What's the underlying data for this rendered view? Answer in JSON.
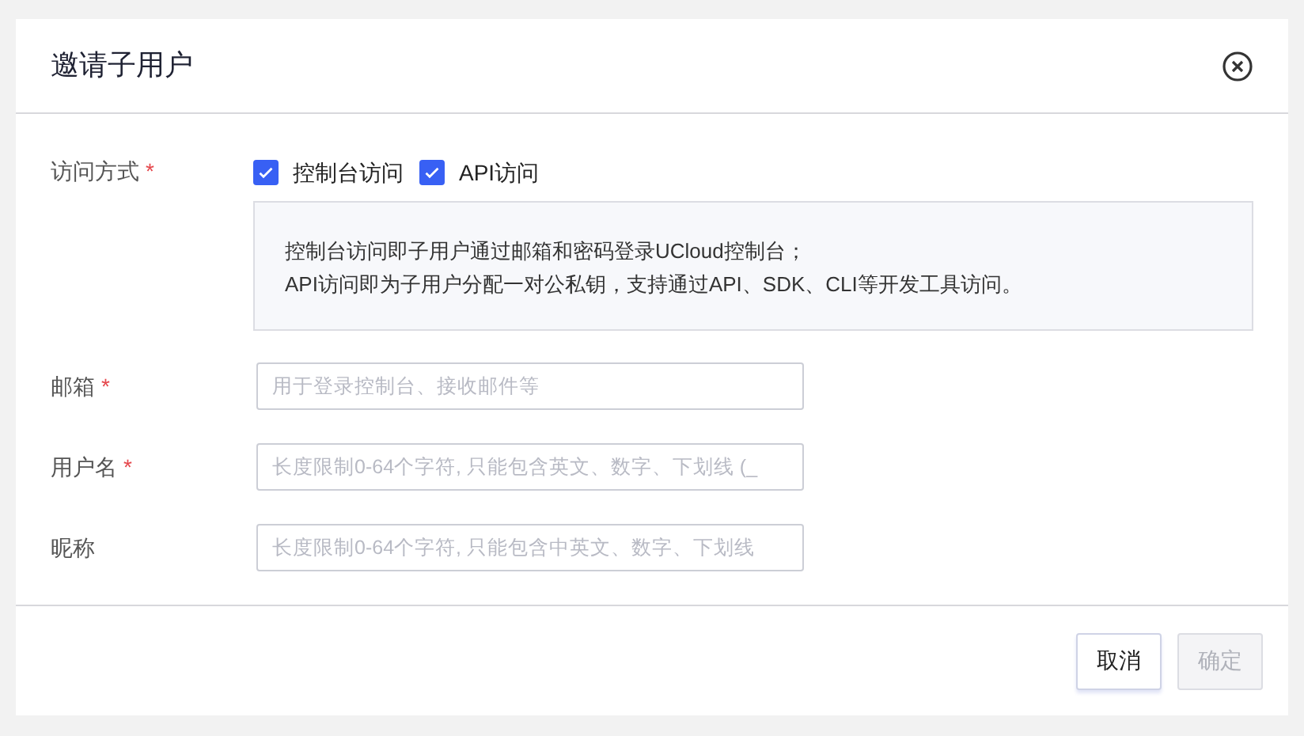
{
  "dialog": {
    "title": "邀请子用户"
  },
  "access": {
    "label": "访问方式",
    "required_mark": "*",
    "options": [
      {
        "label": "控制台访问",
        "checked": true
      },
      {
        "label": "API访问",
        "checked": true
      }
    ],
    "info": [
      "控制台访问即子用户通过邮箱和密码登录UCloud控制台；",
      "API访问即为子用户分配一对公私钥，支持通过API、SDK、CLI等开发工具访问。"
    ]
  },
  "fields": [
    {
      "label": "邮箱",
      "required_mark": "*",
      "placeholder": "用于登录控制台、接收邮件等"
    },
    {
      "label": "用户名",
      "required_mark": "*",
      "placeholder": "长度限制0-64个字符, 只能包含英文、数字、下划线 (_"
    },
    {
      "label": "昵称",
      "placeholder": "长度限制0-64个字符, 只能包含中英文、数字、下划线"
    }
  ],
  "buttons": [
    {
      "label": "取消",
      "disabled": false
    },
    {
      "label": "确定",
      "disabled": true
    }
  ]
}
